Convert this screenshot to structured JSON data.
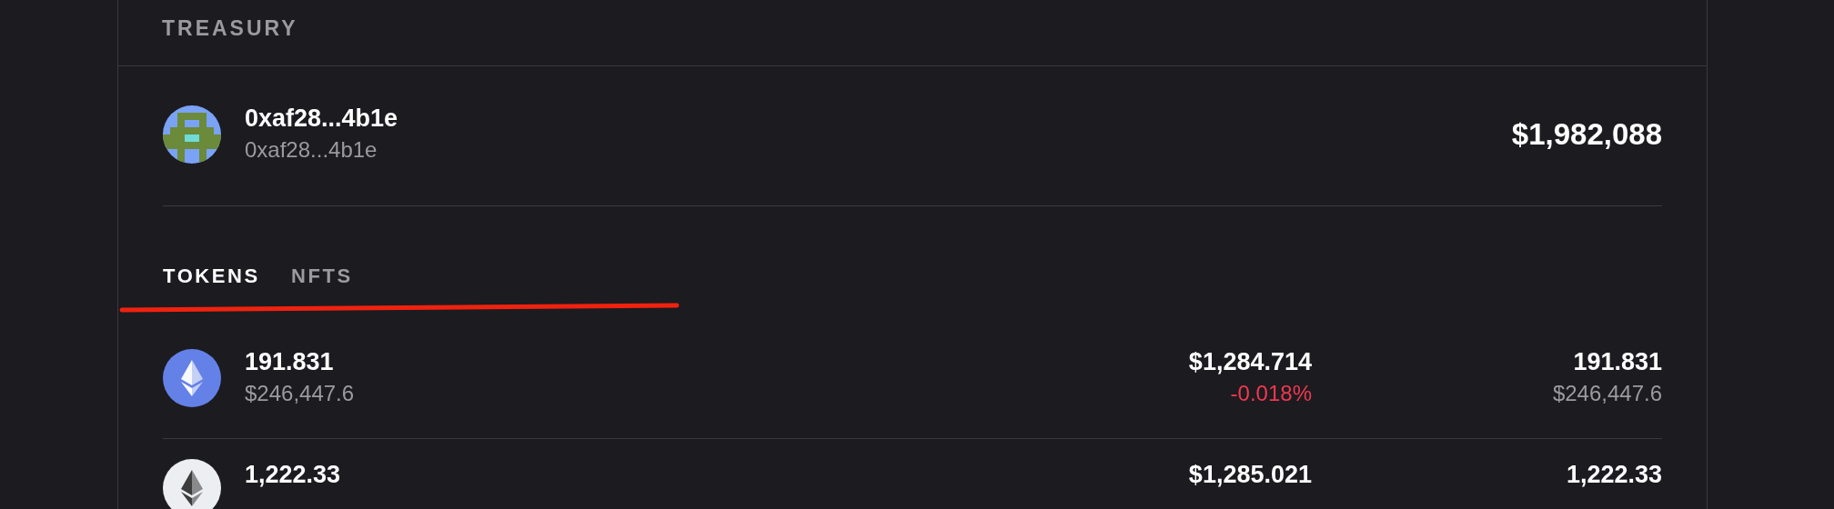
{
  "section_title": "TREASURY",
  "account": {
    "name": "0xaf28...4b1e",
    "address": "0xaf28...4b1e",
    "value": "$1,982,088"
  },
  "tabs": [
    {
      "label": "TOKENS",
      "selected": true
    },
    {
      "label": "NFTS",
      "selected": false
    }
  ],
  "tokens": [
    {
      "kind": "eth",
      "amount": "191.831",
      "amount_value": "$246,447.6",
      "price": "$1,284.714",
      "change": "-0.018%",
      "color": "#f0384f",
      "balance": "191.831",
      "balance_value": "$246,447.6"
    },
    {
      "kind": "eth-light",
      "amount": "1,222.33",
      "price": "$1,285.021",
      "balance": "1,222.33"
    }
  ]
}
